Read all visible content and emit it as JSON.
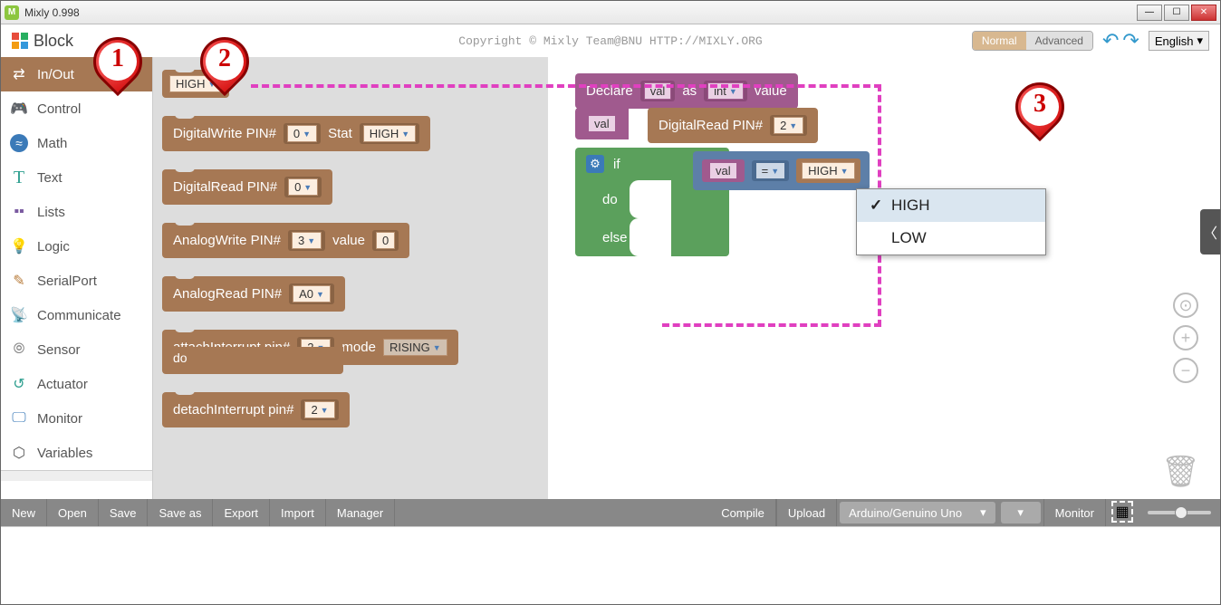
{
  "app": {
    "title": "Mixly 0.998"
  },
  "copyright": "Copyright © Mixly Team@BNU HTTP://MIXLY.ORG",
  "header": {
    "blocks_label": "Block",
    "mode_normal": "Normal",
    "mode_advanced": "Advanced",
    "language": "English"
  },
  "categories": [
    {
      "key": "inout",
      "label": "In/Out",
      "icon": "⇄",
      "color": "#fff",
      "active": true
    },
    {
      "key": "control",
      "label": "Control",
      "icon": "🎮",
      "color": "#5ba05c"
    },
    {
      "key": "math",
      "label": "Math",
      "icon": "≈",
      "color": "#3b7ab8",
      "badge": true
    },
    {
      "key": "text",
      "label": "Text",
      "icon": "T",
      "color": "#2e9f8f"
    },
    {
      "key": "lists",
      "label": "Lists",
      "icon": "▪",
      "color": "#7a5aa0"
    },
    {
      "key": "logic",
      "label": "Logic",
      "icon": "💡",
      "color": "#4a6a90"
    },
    {
      "key": "serial",
      "label": "SerialPort",
      "icon": "✎",
      "color": "#b87c3b"
    },
    {
      "key": "comm",
      "label": "Communicate",
      "icon": "📡",
      "color": "#5ba05c"
    },
    {
      "key": "sensor",
      "label": "Sensor",
      "icon": "⊚",
      "color": "#888"
    },
    {
      "key": "actuator",
      "label": "Actuator",
      "icon": "↺",
      "color": "#2e9f8f"
    },
    {
      "key": "monitor",
      "label": "Monitor",
      "icon": "🖵",
      "color": "#3b7ab8"
    },
    {
      "key": "variables",
      "label": "Variables",
      "icon": "⬡",
      "color": "#555"
    }
  ],
  "flyout": {
    "high": "HIGH",
    "digitalwrite": {
      "label": "DigitalWrite PIN#",
      "pin": "0",
      "stat_label": "Stat",
      "stat": "HIGH"
    },
    "digitalread": {
      "label": "DigitalRead PIN#",
      "pin": "0"
    },
    "analogwrite": {
      "label": "AnalogWrite PIN#",
      "pin": "3",
      "val_label": "value",
      "val": "0"
    },
    "analogread": {
      "label": "AnalogRead PIN#",
      "pin": "A0"
    },
    "attachint": {
      "label": "attachInterrupt pin#",
      "pin": "2",
      "mode_label": "mode",
      "mode": "RISING",
      "do": "do"
    },
    "detachint": {
      "label": "detachInterrupt pin#",
      "pin": "2"
    }
  },
  "workspace": {
    "declare": {
      "declare": "Declare",
      "var": "val",
      "as": "as",
      "type": "int",
      "value": "value"
    },
    "assign": {
      "var": "val"
    },
    "digread": {
      "label": "DigitalRead PIN#",
      "pin": "2"
    },
    "if": {
      "if": "if",
      "do": "do",
      "else": "else"
    },
    "cond": {
      "var": "val",
      "op": "=",
      "val": "HIGH"
    },
    "dropdown": {
      "high": "HIGH",
      "low": "LOW"
    }
  },
  "bottombar": {
    "new": "New",
    "open": "Open",
    "save": "Save",
    "saveas": "Save as",
    "export": "Export",
    "import": "Import",
    "manager": "Manager",
    "compile": "Compile",
    "upload": "Upload",
    "board": "Arduino/Genuino Uno",
    "monitor": "Monitor"
  },
  "markers": {
    "m1": "1",
    "m2": "2",
    "m3": "3"
  }
}
